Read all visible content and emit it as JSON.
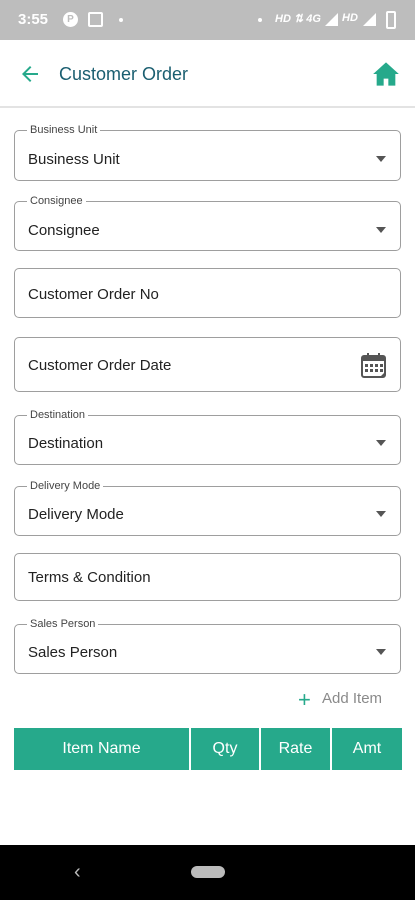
{
  "status": {
    "time": "3:55",
    "network": "HD ⇅ 4G",
    "network2": "HD"
  },
  "appbar": {
    "title": "Customer Order"
  },
  "form": {
    "business_unit": {
      "legend": "Business Unit",
      "value": "Business Unit"
    },
    "consignee": {
      "legend": "Consignee",
      "value": "Consignee"
    },
    "customer_order_no": {
      "placeholder": "Customer Order No"
    },
    "customer_order_date": {
      "placeholder": "Customer Order Date"
    },
    "destination": {
      "legend": "Destination",
      "value": "Destination"
    },
    "delivery_mode": {
      "legend": "Delivery Mode",
      "value": "Delivery Mode"
    },
    "terms": {
      "placeholder": "Terms & Condition"
    },
    "sales_person": {
      "legend": "Sales Person",
      "value": "Sales Person"
    }
  },
  "add_item": {
    "plus": "+",
    "label": "Add Item"
  },
  "table": {
    "headers": [
      "Item Name",
      "Qty",
      "Rate",
      "Amt"
    ]
  },
  "colors": {
    "accent": "#26a98b",
    "title": "#1a5e70",
    "status_bar": "#bdbdbd"
  },
  "icons": [
    "back-arrow-icon",
    "home-icon",
    "calendar-icon",
    "dropdown-caret-icon",
    "plus-icon"
  ]
}
